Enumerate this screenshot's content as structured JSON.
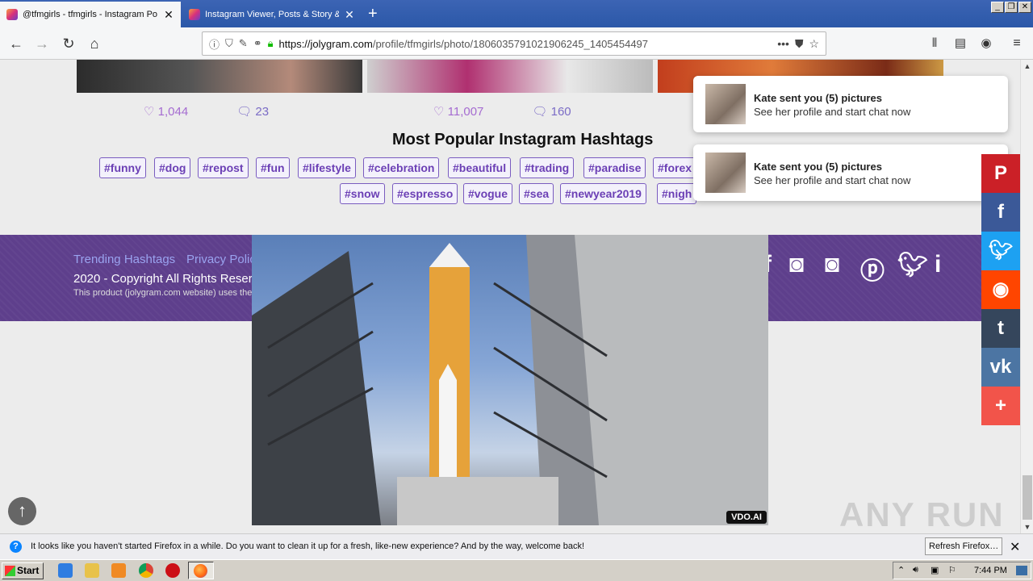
{
  "browser": {
    "tabs": [
      {
        "label": "@tfmgirls - tfmgirls - Instagram Po",
        "close": "✕"
      },
      {
        "label": "Instagram Viewer, Posts & Story &",
        "close": "✕"
      }
    ],
    "new_tab": "+",
    "url_host": "https://jolygram.com",
    "url_path": "/profile/tfmgirls/photo/1806035791021906245_1405454497",
    "more": "•••"
  },
  "posts": [
    {
      "likes": "1,044",
      "comments": "23"
    },
    {
      "likes": "11,007",
      "comments": "160"
    }
  ],
  "hashtags": {
    "title": "Most Popular Instagram Hashtags",
    "row1": [
      "#funny",
      "#dog",
      "#repost",
      "#fun",
      "#lifestyle",
      "#celebration",
      "#beautiful",
      "#trading",
      "#paradise",
      "#forex"
    ],
    "row2": [
      "#snow",
      "#espresso",
      "#vogue",
      "#sea",
      "#newyear2019",
      "#nigh"
    ]
  },
  "footer": {
    "links": [
      "Trending Hashtags",
      "Privacy Polic"
    ],
    "copyright": "2020 - Copyright All Rights Reserv",
    "disclaimer": "This product (jolygram.com website) uses the"
  },
  "video": {
    "badge": "VDO.AI"
  },
  "notifications": [
    {
      "title": "Kate sent you (5) pictures",
      "subtitle": "See her profile and start chat now"
    },
    {
      "title": "Kate sent you (5) pictures",
      "subtitle": "See her profile and start chat now"
    }
  ],
  "share_bar": {
    "colors": [
      "#cb2027",
      "#3b5998",
      "#1da1f2",
      "#ff4500",
      "#35465c",
      "#4c75a3",
      "#f2544a"
    ]
  },
  "firefox_bar": {
    "message": "It looks like you haven't started Firefox in a while. Do you want to clean it up for a fresh, like-new experience? And by the way, welcome back!",
    "button": "Refresh Firefox…"
  },
  "taskbar": {
    "start": "Start",
    "clock": "7:44 PM"
  },
  "watermark": "ANY RUN"
}
